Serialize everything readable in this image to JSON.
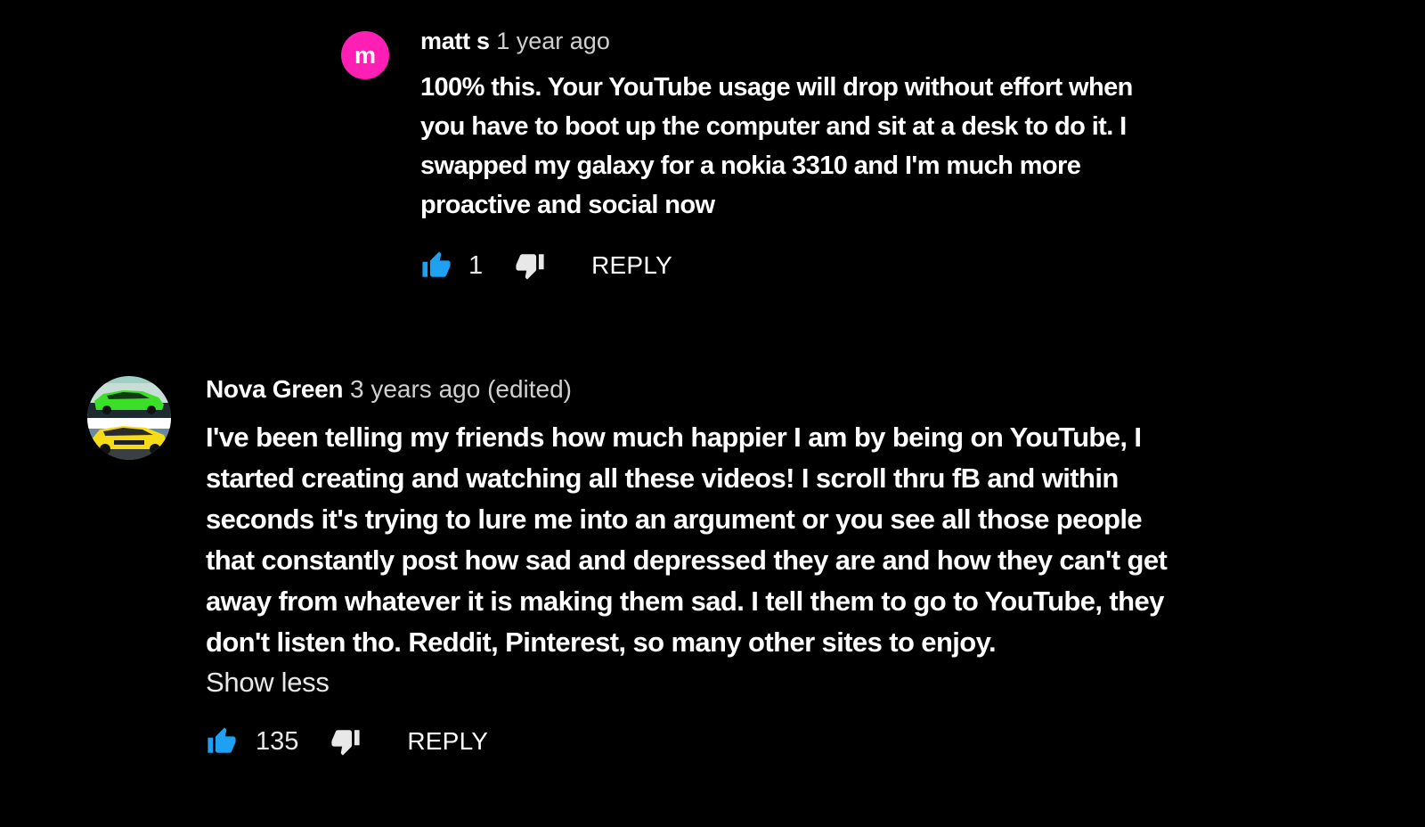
{
  "colors": {
    "background": "#000000",
    "like_icon": "#1ea1f2",
    "reply_avatar_bg": "#ff1fb4",
    "text": "#ffffff"
  },
  "reply_comment": {
    "avatar_letter": "m",
    "author": "matt s",
    "time": "1 year ago",
    "text": "100% this. Your YouTube usage will drop without effort when you have to boot up the computer and sit at a desk to do it. I swapped my galaxy for a nokia 3310 and I'm much more proactive and social now",
    "likes": "1",
    "like_icon": "thumbs-up-icon",
    "dislike_icon": "thumbs-down-icon",
    "reply_label": "REPLY"
  },
  "main_comment": {
    "avatar": "car-avatar",
    "author": "Nova Green",
    "time": "3 years ago (edited)",
    "text": "I've been telling my friends how much happier I am by being on YouTube, I started creating and watching all these videos! I scroll thru fB and within seconds it's trying to lure me into an argument or you see all those people that constantly post how sad and depressed they are and how they can't get away from whatever it is making them sad. I tell them to go to YouTube, they don't listen tho. Reddit, Pinterest, so many other sites to enjoy.",
    "show_less": "Show less",
    "likes": "135",
    "like_icon": "thumbs-up-icon",
    "dislike_icon": "thumbs-down-icon",
    "reply_label": "REPLY"
  }
}
